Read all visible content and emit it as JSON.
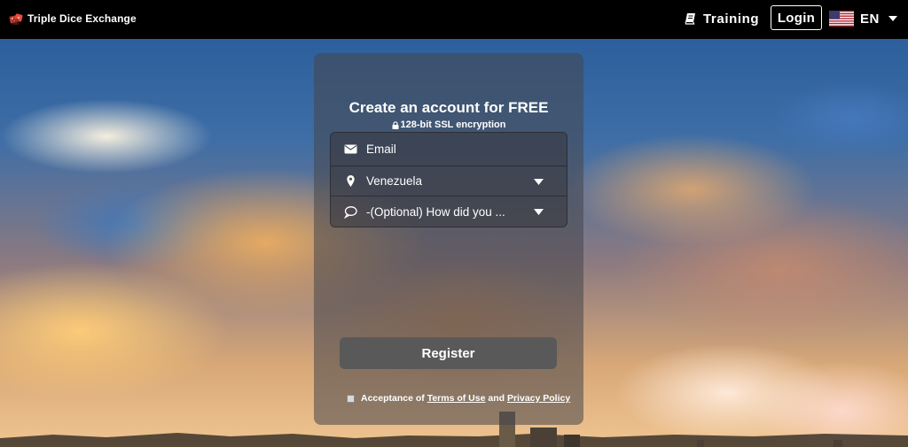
{
  "header": {
    "brand_name": "Triple Dice Exchange",
    "nav_training": "Training",
    "login_label": "Login",
    "language_code": "EN",
    "icons": {
      "brand": "dice-logo-icon",
      "training": "book-icon",
      "language": "us-flag-icon",
      "dropdown": "caret-down-icon"
    }
  },
  "signup": {
    "title": "Create an account for FREE",
    "subtitle": "128-bit SSL encryption",
    "email_placeholder": "Email",
    "country_value": "Venezuela",
    "referral_placeholder": "-(Optional) How did you ...",
    "register_label": "Register",
    "terms_prefix": "Acceptance of ",
    "terms_link": "Terms of Use",
    "terms_and": " and ",
    "privacy_link": "Privacy Policy",
    "icons": {
      "email": "envelope-icon",
      "country": "map-pin-icon",
      "referral": "speech-bubble-icon",
      "secure": "lock-icon"
    }
  },
  "colors": {
    "header_bg": "#000000",
    "panel_bg": "#46464B",
    "button_bg": "#595959",
    "text": "#FFFFFF"
  }
}
